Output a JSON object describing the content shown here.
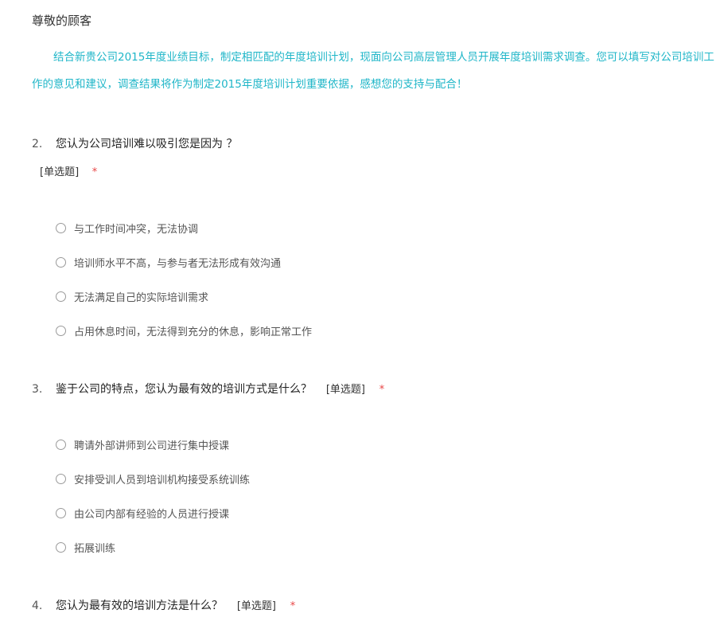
{
  "greeting": "尊敬的顾客",
  "intro": "结合新贵公司2015年度业绩目标，制定相匹配的年度培训计划，现面向公司高层管理人员开展年度培训需求调查。您可以填写对公司培训工作的意见和建议，调查结果将作为制定2015年度培训计划重要依据，感想您的支持与配合！",
  "questions": [
    {
      "number": "2.",
      "text": "您认为公司培训难以吸引您是因为 ？",
      "type_label": "[单选题]",
      "required_mark": "*",
      "options": [
        "与工作时间冲突，无法协调",
        "培训师水平不高，与参与者无法形成有效沟通",
        "无法满足自己的实际培训需求",
        "占用休息时间，无法得到充分的休息，影响正常工作"
      ]
    },
    {
      "number": "3.",
      "text": "鉴于公司的特点，您认为最有效的培训方式是什么？",
      "type_label": "[单选题]",
      "required_mark": "*",
      "options": [
        "聘请外部讲师到公司进行集中授课",
        "安排受训人员到培训机构接受系统训练",
        "由公司内部有经验的人员进行授课",
        "拓展训练"
      ]
    },
    {
      "number": "4.",
      "text": "您认为最有效的培训方法是什么？",
      "type_label": "[单选题]",
      "required_mark": "*",
      "options": []
    }
  ],
  "colors": {
    "intro_text": "#1fb6c8",
    "required_mark": "#e84545",
    "radio_border": "#9a9a9a"
  }
}
